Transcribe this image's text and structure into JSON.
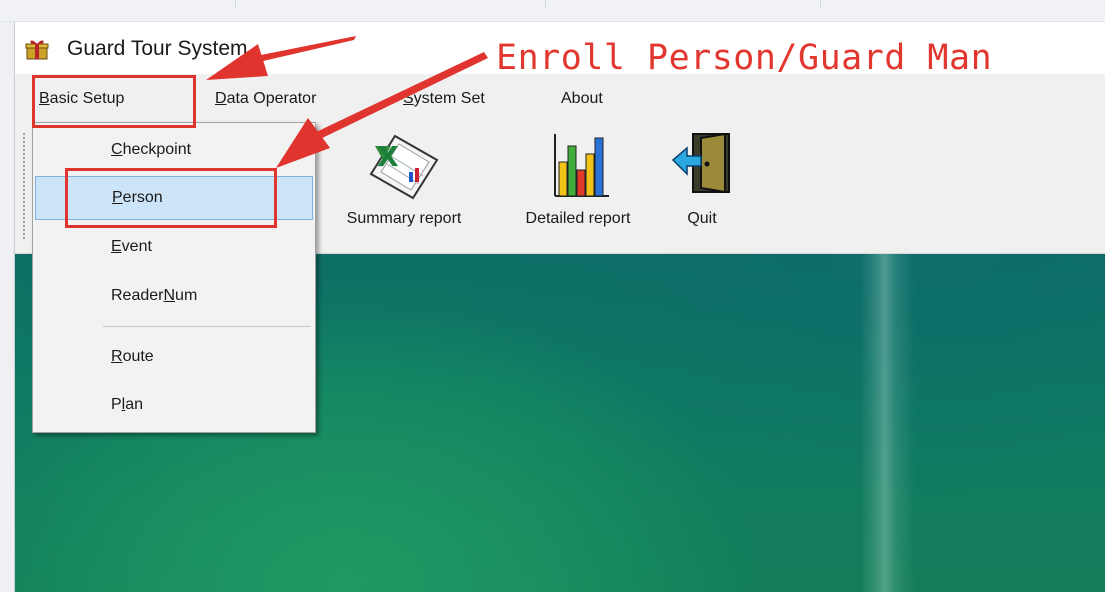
{
  "window": {
    "title": "Guard Tour System"
  },
  "menubar": {
    "items": [
      {
        "mnemonic": "B",
        "rest": "asic Setup"
      },
      {
        "mnemonic": "D",
        "rest": "ata Operator"
      },
      {
        "mnemonic": "S",
        "rest": "ystem Set"
      },
      {
        "mnemonic": "",
        "rest": "About"
      }
    ]
  },
  "toolbar": {
    "buttons": [
      {
        "label": "Summary report",
        "icon": "excel-report-icon"
      },
      {
        "label": "Detailed report",
        "icon": "bar-chart-icon"
      },
      {
        "label": "Quit",
        "icon": "exit-door-icon"
      }
    ]
  },
  "dropdown": {
    "items": [
      {
        "pre": "",
        "mnemonic": "C",
        "post": "heckpoint",
        "selected": false
      },
      {
        "pre": "",
        "mnemonic": "P",
        "post": "erson",
        "selected": true
      },
      {
        "pre": "",
        "mnemonic": "E",
        "post": "vent",
        "selected": false
      },
      {
        "pre": "Reader",
        "mnemonic": "N",
        "post": "um",
        "selected": false
      },
      {
        "pre": "",
        "mnemonic": "R",
        "post": "oute",
        "selected": false
      },
      {
        "pre": "P",
        "mnemonic": "l",
        "post": "an",
        "selected": false
      }
    ]
  },
  "annotation": {
    "text": "Enroll Person/Guard Man",
    "color": "#e2372f"
  },
  "colors": {
    "menu_bg": "#f0f0f0",
    "selected_bg": "#cce4f7",
    "desktop_teal": "#0d6f66",
    "desktop_green": "#1f9a63"
  }
}
